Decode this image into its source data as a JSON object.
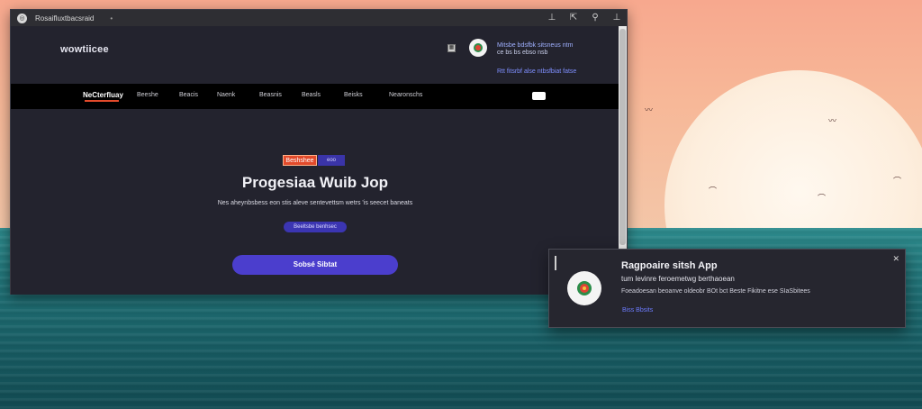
{
  "window": {
    "title": "Rosaifluxtbacsraid",
    "app_icon": "browser-app-icon",
    "title_dot": "•",
    "controls": [
      "pin-icon",
      "share-icon",
      "extensions-icon",
      "minimize-icon"
    ],
    "control_glyphs": [
      "⊥",
      "⇱",
      "⚲",
      "⊥"
    ]
  },
  "site_header": {
    "logo": "wowtiicee",
    "header_icon": "grid-icon",
    "avatar_icon": "user-avatar",
    "lines": [
      "Mitsbe bdsfbk sitsneus ntm",
      "ce bs bs ebso nsb",
      "Rtt fitsrbf alse ntbsfbiat fatse"
    ]
  },
  "nav": {
    "brand": "NeCterfluay",
    "items": [
      "Beeshe",
      "Beacis",
      "Naenk",
      "Beasnis",
      "Beasls",
      "Beisks",
      "Nearonschs"
    ]
  },
  "hero": {
    "badge_orange": "Beshshee",
    "badge_blue": "eoo",
    "title": "Progesiaa Wuib Jop",
    "subtitle": "Nes aheynbsbess eon stis aleve sentevettsm wetrs 'is seecet baneats",
    "chip": "Beeltsbe benhsec",
    "cta": "Sobsé Sibtat"
  },
  "notification": {
    "title": "Ragpoaire sitsh App",
    "line1": "tum levinre feroemetwg berthaoean",
    "line2": "Foeadoesan beoanve oldeobr BOt bct Beste Fikitne ese SIaSbitees",
    "link": "Biss Bbsits",
    "close_icon": "close-icon",
    "avatar_icon": "app-logo-avatar"
  },
  "colors": {
    "accent": "#4b3ecd",
    "badge_orange": "#e24a2b",
    "window_bg": "#23232e"
  }
}
